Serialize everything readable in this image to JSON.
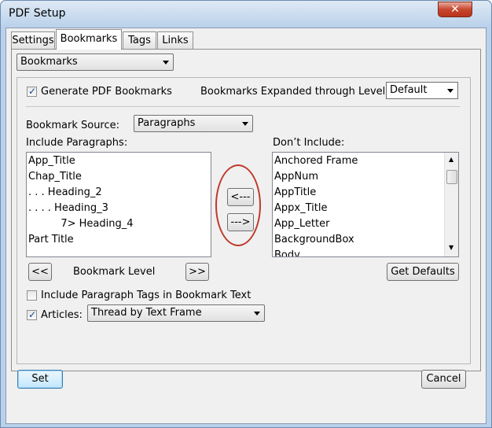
{
  "window": {
    "title": "PDF Setup",
    "close_glyph": "✕"
  },
  "tabs": [
    {
      "label": "Settings"
    },
    {
      "label": "Bookmarks",
      "selected": true
    },
    {
      "label": "Tags"
    },
    {
      "label": "Links"
    }
  ],
  "page_select": {
    "value": "Bookmarks"
  },
  "generate": {
    "label": "Generate PDF Bookmarks",
    "checked": true
  },
  "expanded": {
    "label": "Bookmarks Expanded through Level:",
    "value": "Default"
  },
  "source": {
    "label": "Bookmark Source:",
    "value": "Paragraphs"
  },
  "include": {
    "label": "Include Paragraphs:",
    "items": [
      "App_Title",
      "Chap_Title",
      ". . . Heading_2",
      ". . . . Heading_3",
      "          7> Heading_4",
      "Part Title"
    ]
  },
  "dont_include": {
    "label": "Don’t Include:",
    "items": [
      "Anchored Frame",
      "AppNum",
      "AppTitle",
      "Appx_Title",
      "App_Letter",
      "BackgroundBox",
      "Body"
    ]
  },
  "move_buttons": {
    "left": "<---",
    "right": "--->"
  },
  "level": {
    "decrease": "<<",
    "label": "Bookmark Level",
    "increase": ">>"
  },
  "get_defaults": "Get Defaults",
  "include_tags": {
    "label": "Include Paragraph Tags in Bookmark Text",
    "checked": false
  },
  "articles": {
    "label": "Articles:",
    "checked": true,
    "value": "Thread by Text Frame"
  },
  "set_button": "Set",
  "cancel_button": "Cancel",
  "colors": {
    "highlight_circle": "#c0392b",
    "check": "#1a3e8e"
  }
}
